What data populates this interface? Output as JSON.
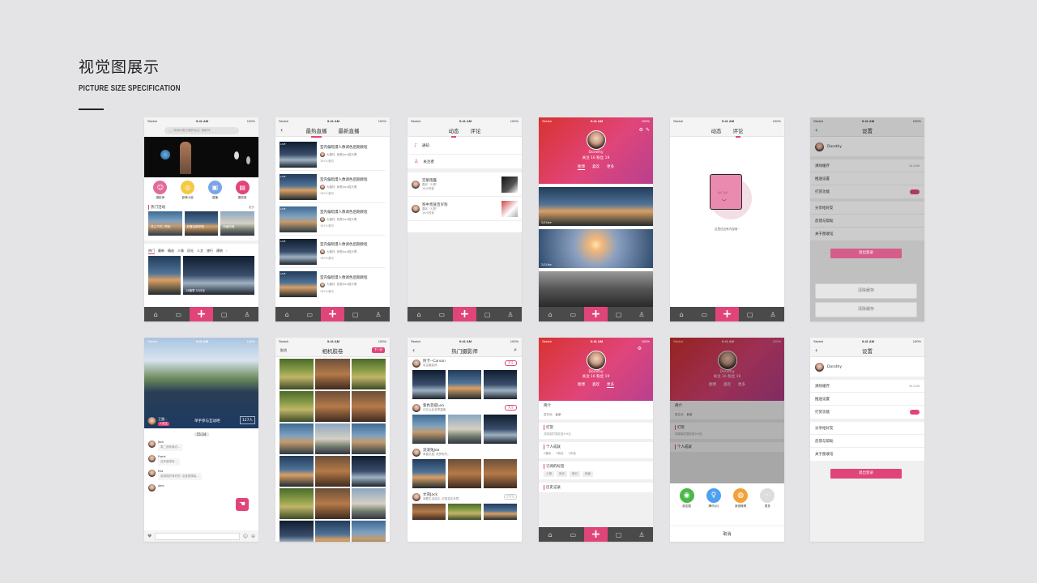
{
  "header": {
    "title": "视觉图展示",
    "subtitle": "PICTURE SIZE SPECIFICATION"
  },
  "status": {
    "carrier": "Sketch",
    "time": "9:41 AM",
    "battery": "100%"
  },
  "colors": {
    "accent": "#e0457a",
    "tabbar": "#4a4a4a",
    "background": "#e4e4e6"
  },
  "screen1": {
    "search_placeholder": "搜索你要去摄的地点, 摄影师",
    "categories": [
      "摄影师",
      "影像小组",
      "直播",
      "图收馆"
    ],
    "hot_title": "热门活动",
    "more": "更多",
    "banners": [
      "逗尘下的八寿街",
      "好喜欢那样啊",
      "西藏风情"
    ],
    "tags": [
      "热门",
      "最新",
      "精选",
      "人像",
      "风光",
      "人文",
      "旅行",
      "建筑"
    ],
    "photo_caption": "18篇草  52评论"
  },
  "screen2": {
    "tabs": [
      "最热直播",
      "最新直播"
    ],
    "live_badge": "LIVE",
    "items": [
      {
        "title": "室内偏暗馒人像调色后期教程",
        "user": "大董好, 我是Jack猫头鹰",
        "count": "197人参与"
      },
      {
        "title": "室内偏暗馒人像调色后期教程",
        "user": "大董好, 我是Jack猫头鹰",
        "count": "197人参与"
      },
      {
        "title": "室内偏暗馒人像调色后期教程",
        "user": "大董好, 我是Jack猫头鹰",
        "count": "197人参与"
      },
      {
        "title": "室内偏暗馒人像调色后期教程",
        "user": "大董好, 我是Jack猫头鹰",
        "count": "197人参与"
      },
      {
        "title": "室内偏暗馒人像调色后期教程",
        "user": "大董好, 我是Jack猫头鹰",
        "count": "197人参与"
      }
    ]
  },
  "screen3": {
    "tabs": [
      "动态",
      "评论"
    ],
    "menu": [
      "通知",
      "关注者"
    ],
    "items": [
      {
        "name": "宫紫雨露",
        "action": "喜欢 \"人物\"",
        "time": "16小时前"
      },
      {
        "name": "狗中贵族百岁狗",
        "action": "喜欢 \"人物\"",
        "time": "16小时前"
      }
    ]
  },
  "screen4": {
    "name": "Dorothy",
    "stats": "关注 16  粉丝 19",
    "tabs": [
      "图博",
      "喜欢",
      "更多"
    ],
    "photo_labels": [
      "2/2Like",
      "2/2Like"
    ]
  },
  "screen5": {
    "tabs": [
      "动态",
      "评论"
    ],
    "empty_text": "这里还没有内容哦~"
  },
  "screen6": {
    "title": "设置",
    "user": "Dorothy",
    "items": [
      {
        "label": "清除缓存",
        "value": "34.01M"
      },
      {
        "label": "推送设置",
        "value": ""
      },
      {
        "label": "打赏功能",
        "value": ""
      },
      {
        "label": "分享给好友",
        "value": ""
      },
      {
        "label": "反馈与帮助",
        "value": ""
      },
      {
        "label": "关于图收馆",
        "value": ""
      }
    ],
    "logout": "退出登录",
    "clear": "清除缓存"
  },
  "screen7": {
    "host": "王狸...",
    "follow": "+关注",
    "live_text": "单手参与互动吧",
    "count": "127人",
    "time": "15:34",
    "messages": [
      {
        "name": "Jack",
        "text": "周二我到海边..."
      },
      {
        "name": "Frank",
        "text": "这声音很有..."
      },
      {
        "name": "Ella",
        "text": "谁得真的有好的, 这音表情给..."
      },
      {
        "name": "Jone",
        "text": ""
      }
    ]
  },
  "screen8": {
    "left": "取消",
    "title": "相机胶卷",
    "right": "下一步"
  },
  "screen9": {
    "title": "热门摄影师",
    "follow": "关注",
    "followed": "已关注",
    "people": [
      {
        "name": "阿卡--Carson",
        "desc": "自由摄影师"
      },
      {
        "name": "紫色菩提Leo",
        "desc": "记忆从此变得温暖"
      },
      {
        "name": "流浪兔Joe",
        "desc": "青春无畏, 勇梦有失。"
      },
      {
        "name": "文哥Jack",
        "desc": "我要生活真实, 记录真实世界。"
      }
    ]
  },
  "screen10": {
    "name": "Dorothy",
    "stats": "关注 16  粉丝 19",
    "tabs": [
      "图博",
      "喜欢",
      "更多"
    ],
    "sections": {
      "intro": "简介",
      "location_label": "居住地",
      "location": "北京",
      "reward": "打赏",
      "reward_text": "共收到打赏红包9.9元",
      "achievement": "个人成就",
      "achievements": [
        "2喜欢",
        "1粉丝",
        "1作品"
      ],
      "tags_title": "订阅的标签",
      "tags": [
        "人物",
        "风光",
        "旅行",
        "夜景"
      ],
      "history": "历史记录"
    }
  },
  "screen11": {
    "share": [
      "朋友圈",
      "腾讯QQ",
      "新浪微博",
      "更多"
    ],
    "cancel": "取消"
  }
}
